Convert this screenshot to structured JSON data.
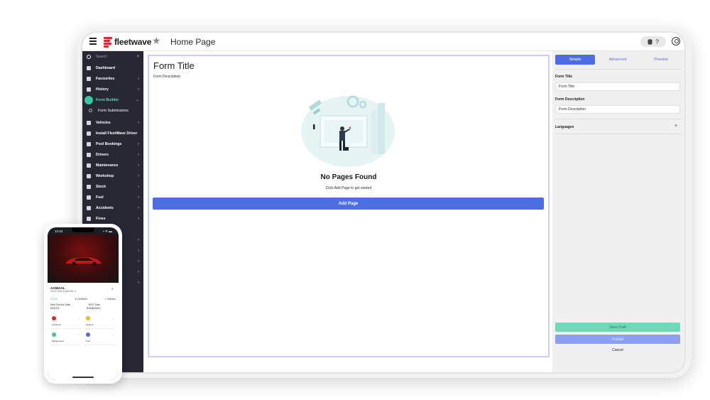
{
  "app": {
    "brand": "fleetwave",
    "page_title": "Home Page",
    "db_help": "?"
  },
  "sidebar": {
    "search_placeholder": "Search",
    "search_clear": "×",
    "items": [
      {
        "label": "Dashboard",
        "chevron": ""
      },
      {
        "label": "Favourites",
        "chevron": "›"
      },
      {
        "label": "History",
        "chevron": "›"
      },
      {
        "label": "Form Builder",
        "chevron": "⌄"
      },
      {
        "label": "Form Submissions",
        "chevron": ""
      },
      {
        "label": "Vehicles",
        "chevron": "›"
      },
      {
        "label": "Install FleetWave Driver",
        "chevron": ""
      },
      {
        "label": "Pool Bookings",
        "chevron": "›"
      },
      {
        "label": "Drivers",
        "chevron": "›"
      },
      {
        "label": "Maintenance",
        "chevron": "›"
      },
      {
        "label": "Workshop",
        "chevron": "›"
      },
      {
        "label": "Stock",
        "chevron": "›"
      },
      {
        "label": "Fuel",
        "chevron": "›"
      },
      {
        "label": "Accidents",
        "chevron": "›"
      },
      {
        "label": "Fines",
        "chevron": "›"
      }
    ],
    "extra_chevrons": [
      "›",
      "›",
      "›",
      "›",
      "›",
      "›"
    ]
  },
  "canvas": {
    "form_title": "Form Title",
    "form_description": "Form Description",
    "empty_title": "No Pages Found",
    "empty_subtitle": "Click Add Page to get started",
    "add_page_label": "Add Page"
  },
  "panel": {
    "tabs": [
      "Simple",
      "Advanced",
      "Preview"
    ],
    "form_title_label": "Form Title",
    "form_title_value": "Form Title",
    "form_desc_label": "Form Description",
    "form_desc_value": "Form Description",
    "languages_label": "Languages",
    "languages_add": "+",
    "save_draft": "Save Draft",
    "publish": "Publish",
    "cancel": "Cancel"
  },
  "phone": {
    "time": "13:42",
    "signal": "▪ ᯤ ▬",
    "registration": "AA69AAL",
    "model": "2019 TESLA MODEL 3",
    "status": "● Live",
    "mileage": "● 22000mi",
    "fuel": "⚡ Electric",
    "next_service_label": "Next Service Date",
    "next_service_value": "02/07/1",
    "mot_label": "MOT Date",
    "mot_value": "31/08/2022",
    "tiles": [
      {
        "label": "Accidents",
        "color": "#e0262a"
      },
      {
        "label": "Defects",
        "color": "#f0b429"
      },
      {
        "label": "Maintenance",
        "color": "#3fc49f"
      },
      {
        "label": "Fuel",
        "color": "#4f6de3"
      }
    ],
    "search_icon": "⌕"
  },
  "colors": {
    "accent": "#4f6de3",
    "sidebar_bg": "#262833",
    "active_green": "#3fc49f",
    "brand_red": "#e0262a"
  }
}
